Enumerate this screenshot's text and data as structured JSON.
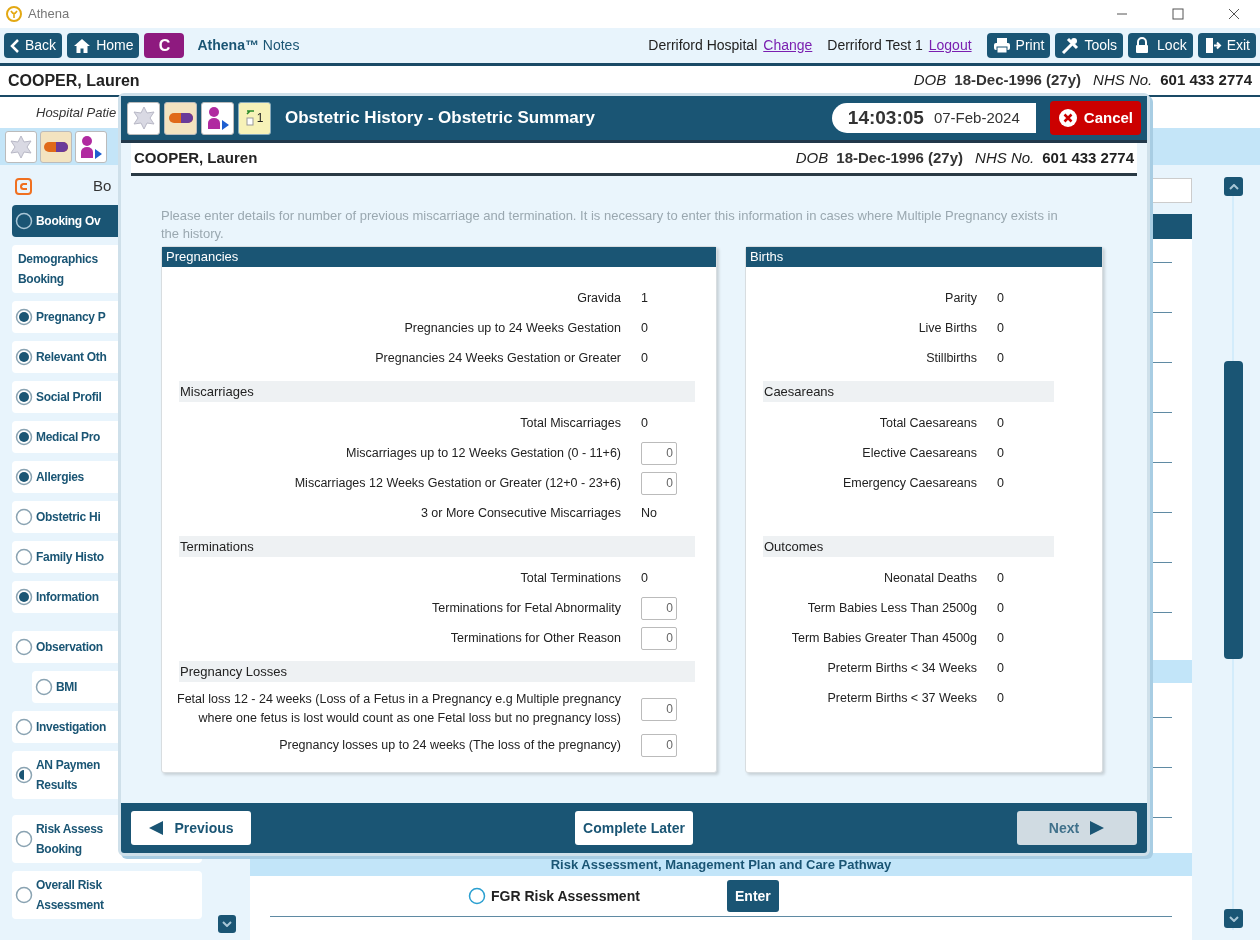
{
  "window": {
    "title": "Athena"
  },
  "toolbar": {
    "nav_buttons": [
      {
        "kind": "back",
        "label": "Back"
      },
      {
        "kind": "home",
        "label": "Home"
      },
      {
        "kind": "badge",
        "label": "C"
      }
    ],
    "app_name": "**Athena™** Notes",
    "site": "Derriford Hospital",
    "site_link": "Change",
    "user": "Derriford Test 1",
    "user_link": "Logout",
    "action_buttons": [
      {
        "kind": "print",
        "label": "Print"
      },
      {
        "kind": "tools",
        "label": "Tools"
      },
      {
        "kind": "lock",
        "label": "Lock"
      },
      {
        "kind": "exit",
        "label": "Exit"
      }
    ]
  },
  "patient": {
    "name": "COOPER, Lauren",
    "dob_label": "DOB",
    "dob": "18-Dec-1996 (27y)",
    "nhs_label": "NHS No.",
    "nhs": "601 433 2774"
  },
  "background": {
    "subtitle": "Hospital Patie",
    "sidebar_title": "Bo",
    "sidebar": [
      {
        "label": "Booking Ov",
        "kind": "empty",
        "selected": true
      },
      {
        "label": "Demographics\nBooking",
        "kind": "plain",
        "selected": false
      },
      {
        "label": "Pregnancy P",
        "kind": "filled",
        "selected": false
      },
      {
        "label": "Relevant Oth",
        "kind": "filled",
        "selected": false
      },
      {
        "label": "Social Profil",
        "kind": "filled",
        "selected": false
      },
      {
        "label": "Medical Pro",
        "kind": "filled",
        "selected": false
      },
      {
        "label": "Allergies",
        "kind": "filled",
        "selected": false
      },
      {
        "label": "Obstetric Hi",
        "kind": "empty",
        "selected": false
      },
      {
        "label": "Family Histo",
        "kind": "empty",
        "selected": false
      },
      {
        "label": "Information",
        "kind": "filled",
        "selected": false
      },
      {
        "label": "Observation",
        "kind": "empty",
        "selected": false,
        "children": [
          {
            "label": "BMI",
            "kind": "empty",
            "selected": false
          }
        ]
      },
      {
        "label": "Investigation",
        "kind": "empty",
        "selected": false
      },
      {
        "label": "AN Paymen\nResults",
        "kind": "half",
        "selected": false
      },
      {
        "label": "Risk Assess\nBooking",
        "kind": "empty",
        "selected": false
      },
      {
        "label": "Overall Risk\nAssessment",
        "kind": "empty",
        "selected": false
      }
    ],
    "section_title": "Risk Assessment, Management Plan and Care Pathway",
    "task": {
      "label": "FGR Risk Assessment",
      "kind": "empty",
      "button": "Enter"
    }
  },
  "dialog": {
    "title": "Obstetric History - Obstetric Summary",
    "calendar_day": "1",
    "time": "14:03:05",
    "date": "07-Feb-2024",
    "cancel": "Cancel",
    "patient": {
      "name": "COOPER, Lauren",
      "dob_label": "DOB",
      "dob": "18-Dec-1996 (27y)",
      "nhs_label": "NHS No.",
      "nhs": "601 433 2774"
    },
    "note": "Please enter details for number of previous miscarriage and termination.  It is necessary to enter this information in cases where Multiple Pregnancy exists in the history.",
    "panels": [
      {
        "title": "Pregnancies",
        "groups": [
          {
            "rows": [
              {
                "kind": "value",
                "label": "Gravida",
                "value": "1"
              },
              {
                "kind": "value",
                "label": "Pregnancies up to 24 Weeks Gestation",
                "value": "0"
              },
              {
                "kind": "value",
                "label": "Pregnancies 24 Weeks Gestation or Greater",
                "value": "0"
              }
            ]
          },
          {
            "heading": "Miscarriages",
            "rows": [
              {
                "kind": "value",
                "label": "Total Miscarriages",
                "value": "0"
              },
              {
                "kind": "input",
                "label": "Miscarriages up to 12 Weeks Gestation (0 - 11+6)",
                "value": "0"
              },
              {
                "kind": "input",
                "label": "Miscarriages 12 Weeks Gestation or Greater (12+0 - 23+6)",
                "value": "0"
              },
              {
                "kind": "value",
                "label": "3 or More Consecutive Miscarriages",
                "value": "No"
              }
            ]
          },
          {
            "heading": "Terminations",
            "rows": [
              {
                "kind": "value",
                "label": "Total Terminations",
                "value": "0"
              },
              {
                "kind": "input",
                "label": "Terminations for Fetal Abnormality",
                "value": "0"
              },
              {
                "kind": "input",
                "label": "Terminations for Other Reason",
                "value": "0"
              }
            ]
          },
          {
            "heading": "Pregnancy Losses",
            "rows": [
              {
                "kind": "input",
                "label": "Fetal loss 12 - 24 weeks (Loss of a Fetus in a Pregnancy e.g Multiple pregnancy where one fetus is lost would count as one Fetal loss but no pregnancy loss)",
                "value": "0"
              },
              {
                "kind": "input",
                "label": "Pregnancy losses up to 24 weeks (The loss of the pregnancy)",
                "value": "0"
              }
            ]
          }
        ]
      },
      {
        "title": "Births",
        "groups": [
          {
            "rows": [
              {
                "kind": "value",
                "label": "Parity",
                "value": "0"
              },
              {
                "kind": "value",
                "label": "Live Births",
                "value": "0"
              },
              {
                "kind": "value",
                "label": "Stillbirths",
                "value": "0"
              }
            ]
          },
          {
            "heading": "Caesareans",
            "rows": [
              {
                "kind": "value",
                "label": "Total Caesareans",
                "value": "0"
              },
              {
                "kind": "value",
                "label": "Elective Caesareans",
                "value": "0"
              },
              {
                "kind": "value",
                "label": "Emergency Caesareans",
                "value": "0"
              }
            ]
          },
          {
            "heading": "Outcomes",
            "rows": [
              {
                "kind": "value",
                "label": "Neonatal Deaths",
                "value": "0"
              },
              {
                "kind": "value",
                "label": "Term Babies Less Than 2500g",
                "value": "0"
              },
              {
                "kind": "value",
                "label": "Term Babies Greater Than 4500g",
                "value": "0"
              },
              {
                "kind": "value",
                "label": "Preterm Births < 34 Weeks",
                "value": "0"
              },
              {
                "kind": "value",
                "label": "Preterm Births < 37 Weeks",
                "value": "0"
              }
            ]
          }
        ]
      }
    ],
    "footer": [
      {
        "kind": "previous",
        "label": "Previous",
        "disabled": false
      },
      {
        "kind": "later",
        "label": "Complete Later",
        "disabled": false
      },
      {
        "kind": "next",
        "label": "Next",
        "disabled": true
      }
    ]
  }
}
